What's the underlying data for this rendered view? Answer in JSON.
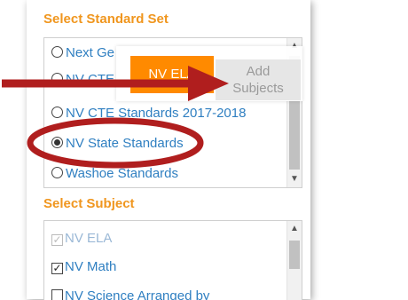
{
  "standard_set": {
    "heading": "Select Standard Set",
    "options": [
      "Next Ge",
      "NV CTE",
      "NV CTE Standards 2017-2018",
      "NV State Standards",
      "Washoe Standards"
    ],
    "selected": "NV State Standards"
  },
  "subject": {
    "heading": "Select Subject",
    "items": [
      {
        "label": "NV ELA",
        "checked": true,
        "disabled": true
      },
      {
        "label": "NV Math",
        "checked": true,
        "disabled": false
      },
      {
        "label": "NV Science Arranged by",
        "checked": false,
        "disabled": false
      }
    ]
  },
  "popup": {
    "tab_label": "NV ELA",
    "add_label": "Add Subjects"
  },
  "colors": {
    "heading": "#f0961e",
    "link": "#2f7fc1",
    "tab": "#ff8a00",
    "annotation": "#b01e1e"
  },
  "icons": {
    "radio": "radio-icon",
    "checkbox": "checkbox-icon",
    "arrow": "arrow-annotation-icon",
    "ellipse": "ellipse-annotation-icon"
  }
}
